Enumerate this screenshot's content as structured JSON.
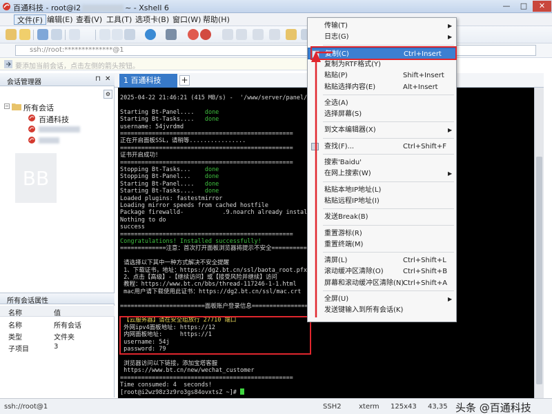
{
  "window": {
    "app_name": "百通科技",
    "title_prefix": "root@i2",
    "title_suffix": "~ - Xshell 6",
    "controls": [
      "—",
      "□",
      "✕"
    ]
  },
  "menubar": [
    "文件(F)",
    "编辑(E)",
    "查看(V)",
    "工具(T)",
    "选项卡(B)",
    "窗口(W)",
    "帮助(H)"
  ],
  "address": {
    "value": "ssh://root:**************@1"
  },
  "hint": "要添加当前会话，点击左侧的箭头按钮。",
  "sidebar": {
    "title": "会话管理器",
    "pin": "⊓",
    "close": "✕",
    "tree": {
      "root_label": "所有会话",
      "items": [
        {
          "label": "百通科技"
        }
      ]
    }
  },
  "properties": {
    "title": "所有会话属性",
    "col_name": "名称",
    "col_value": "值",
    "rows": [
      {
        "name": "名称",
        "value": "所有会话"
      },
      {
        "name": "类型",
        "value": "文件夹"
      },
      {
        "name": "子项目",
        "value": "3"
      }
    ]
  },
  "tab": {
    "label": "1 百通科技",
    "add": "+"
  },
  "terminal": {
    "lines": [
      {
        "t": "2025-04-22 21:46:21 (415 MB/s) -  '/www/server/panel/data/s"
      },
      {
        "t": ""
      },
      {
        "t": "Starting Bt-Panel....   ",
        "ok": "done"
      },
      {
        "t": "Starting Bt-Tasks....   ",
        "ok": "done"
      },
      {
        "t": "username: 54jvrdmd"
      },
      {
        "t": "================================================="
      },
      {
        "t": "正在开启面板SSL，请稍等................"
      },
      {
        "t": "================================================="
      },
      {
        "t": "证书开启成功！"
      },
      {
        "t": "================================================="
      },
      {
        "t": "Stopping Bt-Tasks...    ",
        "ok": "done"
      },
      {
        "t": "Stopping Bt-Panel...    ",
        "ok": "done"
      },
      {
        "t": "Starting Bt-Panel....   ",
        "ok": "done"
      },
      {
        "t": "Starting Bt-Tasks....   ",
        "ok": "done"
      },
      {
        "t": "Loaded plugins: fastestmirror"
      },
      {
        "t": "Loading mirror speeds from cached hostfile"
      },
      {
        "t": "Package firewalld-           .9.noarch already installed"
      },
      {
        "t": "Nothing to do"
      },
      {
        "t": "success"
      },
      {
        "t": "================================================="
      },
      {
        "t": "Congratulations! Installed successfully!",
        "cls": "green"
      },
      {
        "t": "=============注意：首次打开面板浏览器将提示不安全================"
      },
      {
        "t": ""
      },
      {
        "t": " 请选择以下其中一种方式解决不安全提醒"
      },
      {
        "t": " 1、下载证书，地址：https://dg2.bt.cn/ssl/baota_root.pfx"
      },
      {
        "t": " 2、点击【高级】-【继续访问】或【接受风险并继续】访问"
      },
      {
        "t": " 教程：https://www.bt.cn/bbs/thread-117246-1-1.html"
      },
      {
        "t": " mac用户请下载使用此证书：https://dg2.bt.cn/ssl/mac.crt"
      },
      {
        "t": ""
      },
      {
        "t": "========================面板账户登录信息=========================="
      },
      {
        "t": ""
      },
      {
        "t": " 【云服务器】请在安全组放行 27710 端口",
        "cls": "yellow"
      },
      {
        "t": " 外网ipv4面板地址: https://12"
      },
      {
        "t": " 内网面板地址:     https://1"
      },
      {
        "t": " username: 54j"
      },
      {
        "t": " password: 79"
      },
      {
        "t": ""
      },
      {
        "t": " 浏览器访问以下链接，添加宝塔客服"
      },
      {
        "t": " https://www.bt.cn/new/wechat_customer"
      },
      {
        "t": "================================================="
      },
      {
        "t": "Time consumed: 4  seconds!"
      },
      {
        "t": "[root@i2wz98z3z9ro3gs84ovxtsZ ~]# "
      }
    ]
  },
  "statusbar": {
    "left": "ssh://root@1",
    "protocol": "SSH2",
    "term": "xterm",
    "size": "125x43",
    "pos": "43,35",
    "watermark": "头条 @百通科技"
  },
  "context_menu": {
    "items": [
      {
        "label": "传输(T)",
        "shortcut": "",
        "arrow": true
      },
      {
        "label": "日志(G)",
        "shortcut": "",
        "arrow": true
      },
      {
        "sep": true
      },
      {
        "label": "复制(C)",
        "shortcut": "Ctrl+Insert",
        "arrow": false,
        "hl": true,
        "icon": "copy-icon"
      },
      {
        "label": "复制为RTF格式(Y)",
        "shortcut": "",
        "arrow": false
      },
      {
        "label": "粘贴(P)",
        "shortcut": "Shift+Insert",
        "arrow": false
      },
      {
        "label": "粘贴选择内容(E)",
        "shortcut": "Alt+Insert",
        "arrow": false
      },
      {
        "sep": true
      },
      {
        "label": "全选(A)",
        "shortcut": "",
        "arrow": false
      },
      {
        "label": "选择屏幕(S)",
        "shortcut": "",
        "arrow": false
      },
      {
        "sep": true
      },
      {
        "label": "到文本编辑器(X)",
        "shortcut": "",
        "arrow": true
      },
      {
        "sep": true
      },
      {
        "label": "查找(F)...",
        "shortcut": "Ctrl+Shift+F",
        "arrow": false,
        "icon": "search-icon"
      },
      {
        "sep": true
      },
      {
        "label": "搜索'Baidu'",
        "shortcut": "",
        "arrow": false
      },
      {
        "label": "在网上搜索(W)",
        "shortcut": "",
        "arrow": true
      },
      {
        "sep": true
      },
      {
        "label": "粘贴本地IP地址(L)",
        "shortcut": "",
        "arrow": false
      },
      {
        "label": "粘贴远程IP地址(I)",
        "shortcut": "",
        "arrow": false
      },
      {
        "sep": true
      },
      {
        "label": "发送Break(B)",
        "shortcut": "",
        "arrow": false
      },
      {
        "sep": true
      },
      {
        "label": "重置游标(R)",
        "shortcut": "",
        "arrow": false
      },
      {
        "label": "重置终端(M)",
        "shortcut": "",
        "arrow": false
      },
      {
        "sep": true
      },
      {
        "label": "清屏(L)",
        "shortcut": "Ctrl+Shift+L",
        "arrow": false
      },
      {
        "label": "滚动缓冲区清除(O)",
        "shortcut": "Ctrl+Shift+B",
        "arrow": false
      },
      {
        "label": "屏幕和滚动缓冲区清除(N)",
        "shortcut": "Ctrl+Shift+A",
        "arrow": false
      },
      {
        "sep": true
      },
      {
        "label": "全屏(U)",
        "shortcut": "",
        "arrow": true
      },
      {
        "label": "发送键输入到所有会话(K)",
        "shortcut": "",
        "arrow": false
      }
    ]
  },
  "watermark_logo": "BB",
  "colors": {
    "accent": "#3c7fd1",
    "annotation_red": "#e0262d",
    "terminal_bg": "#000000"
  }
}
